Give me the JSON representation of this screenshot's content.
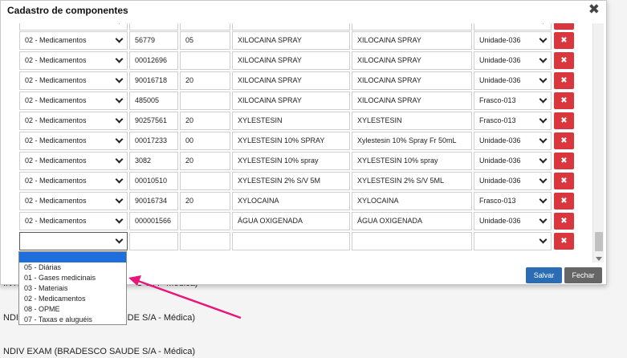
{
  "background": {
    "lines": [
      "INTI",
      "U S A - Médica)",
      "NDIV EXAM (BRADESCO SAUDE S/A - Médica)",
      "NDIV EXAM (BRADESCO SAUDE S/A - Médica)"
    ]
  },
  "modal": {
    "title": "Cadastro de componentes",
    "close_label": "✖",
    "delete_label": "✖",
    "rows": [
      {
        "category": "02 - Medicamentos",
        "code": "56779",
        "qty": "05",
        "name": "XILOCAINA SPRAY",
        "desc": "XILOCAINA SPRAY",
        "unit": "Unidade-036"
      },
      {
        "category": "02 - Medicamentos",
        "code": "00012696",
        "qty": "",
        "name": "XILOCAINA SPRAY",
        "desc": "XILOCAINA SPRAY",
        "unit": "Unidade-036"
      },
      {
        "category": "02 - Medicamentos",
        "code": "90016718",
        "qty": "20",
        "name": "XILOCAINA SPRAY",
        "desc": "XILOCAINA SPRAY",
        "unit": "Unidade-036"
      },
      {
        "category": "02 - Medicamentos",
        "code": "485005",
        "qty": "",
        "name": "XILOCAINA SPRAY",
        "desc": "XILOCAINA SPRAY",
        "unit": "Frasco-013"
      },
      {
        "category": "02 - Medicamentos",
        "code": "90257561",
        "qty": "20",
        "name": "XYLESTESIN",
        "desc": "XYLESTESIN",
        "unit": "Frasco-013"
      },
      {
        "category": "02 - Medicamentos",
        "code": "00017233",
        "qty": "00",
        "name": "XYLESTESIN 10% SPRAY",
        "desc": "Xylestesin 10% Spray Fr 50mL",
        "unit": "Unidade-036"
      },
      {
        "category": "02 - Medicamentos",
        "code": "3082",
        "qty": "20",
        "name": "XYLESTESIN 10% spray",
        "desc": "XYLESTESIN 10% spray",
        "unit": "Unidade-036"
      },
      {
        "category": "02 - Medicamentos",
        "code": "00010510",
        "qty": "",
        "name": "XYLESTESIN 2% S/V 5M",
        "desc": "XYLESTESIN 2% S/V 5ML",
        "unit": "Unidade-036"
      },
      {
        "category": "02 - Medicamentos",
        "code": "90016734",
        "qty": "20",
        "name": "XYLOCAINA",
        "desc": "XYLOCAINA",
        "unit": "Frasco-013"
      },
      {
        "category": "02 - Medicamentos",
        "code": "000001566",
        "qty": "",
        "name": "ÁGUA OXIGENADA",
        "desc": "ÁGUA OXIGENADA",
        "unit": "Unidade-036"
      },
      {
        "category": "",
        "code": "",
        "qty": "",
        "name": "",
        "desc": "",
        "unit": ""
      }
    ],
    "dropdown_options": [
      "",
      "05 - Diárias",
      "01 - Gases medicinais",
      "03 - Materiais",
      "02 - Medicamentos",
      "08 - OPME",
      "07 - Taxas e aluguéis"
    ],
    "buttons": {
      "save": "Salvar",
      "close": "Fechar"
    }
  },
  "colors": {
    "accent_blue": "#2a6db5",
    "delete_red": "#d9363e",
    "highlight": "#1e6fdc",
    "annotation": "#e8157a"
  }
}
